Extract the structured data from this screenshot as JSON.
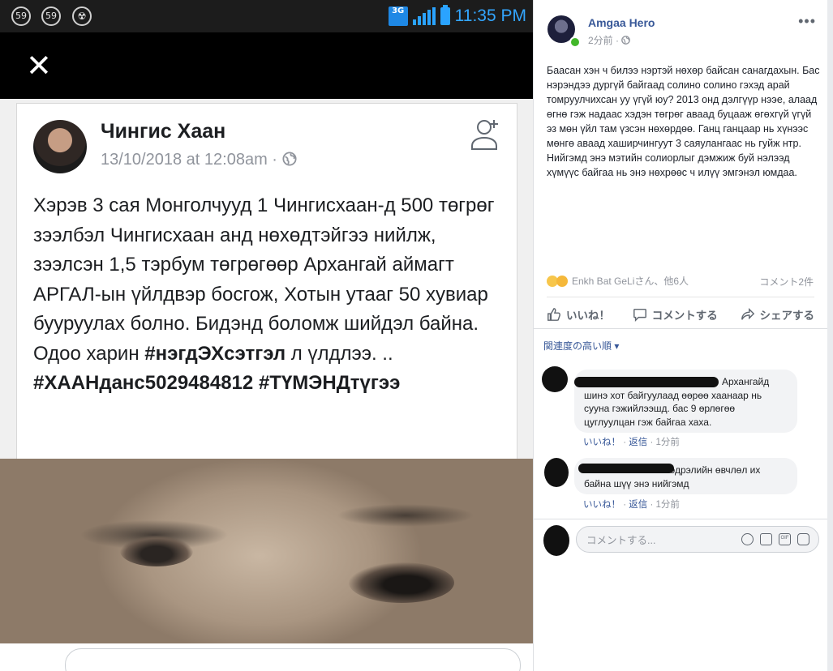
{
  "phone": {
    "status": {
      "badge1": "59",
      "badge2": "59",
      "net": "3G",
      "time": "11:35 PM"
    },
    "post": {
      "author": "Чингис Хаан",
      "date": "13/10/2018 at 12:08am · ",
      "body_plain": "Хэрэв 3 сая Монголчууд 1 Чингисхаан-д 500 төгрөг зээлбэл Чингисхаан анд нөхөдтэйгээ нийлж, зээлсэн 1,5 тэрбум төгрөгөөр Архангай аймагт АРГАЛ-ын үйлдвэр босгож, Хотын утааг 50 хувиар бууруулах болно. Бидэнд боломж шийдэл байна. Одоо харин ",
      "tag1": "#нэгдЭХсэтгэл",
      "body_mid": " л үлдлээ. ..  ",
      "tag2": "#ХААНданс5029484812",
      "tag3": "#ТҮМЭНДтүгээ"
    }
  },
  "fb": {
    "author": "Amgaa Hero",
    "time": "2分前 · ",
    "body": "Баасан хэн ч билээ нэртэй нөхөр байсан санагдахын. Бас нэрэндээ дургүй байгаад солино солино гэхэд арай томруулчихсан уу үгүй юу? 2013 онд дэлгүүр нээе, алаад өгнө гэж надаас хэдэн төгрөг аваад буцааж өгөхгүй үгүй эз мөн үйл там үзсэн нөхөрдөө. Ганц ганцаар нь хүнээс мөнгө аваад хаширчингуут 3 саяулангаас нь гуйж нтр. Нийгэмд энэ мэтийн солиорлыг дэмжиж буй нэлээд хүмүүс байгаа нь энэ нөхрөөс ч илүү эмгэнэл юмдаа.",
    "reactions": "Enkh Bat GeLiさん、他6人",
    "comment_count": "コメント2件",
    "actions": {
      "like": "いいね！",
      "comment": "コメントする",
      "share": "シェアする"
    },
    "sort": "関連度の高い順 ▾",
    "comments": [
      {
        "text": "Архангайд шинэ хот байгуулаад өөрөө хаанаар нь сууна гэжийлээшд. бас 9 өрлөгөө цуглуулцан гэж байгаа хаха.",
        "like": "いいね！",
        "reply": "返信",
        "time": "1分前"
      },
      {
        "text": "Мэдрэлийн өвчлөл их байна шүү энэ нийгэмд",
        "like": "いいね！",
        "reply": "返信",
        "time": "1分前"
      }
    ],
    "composer_placeholder": "コメントする..."
  },
  "colors": {
    "fb_link": "#385898",
    "status_blue": "#2aa3ff",
    "online_green": "#42b72a"
  }
}
